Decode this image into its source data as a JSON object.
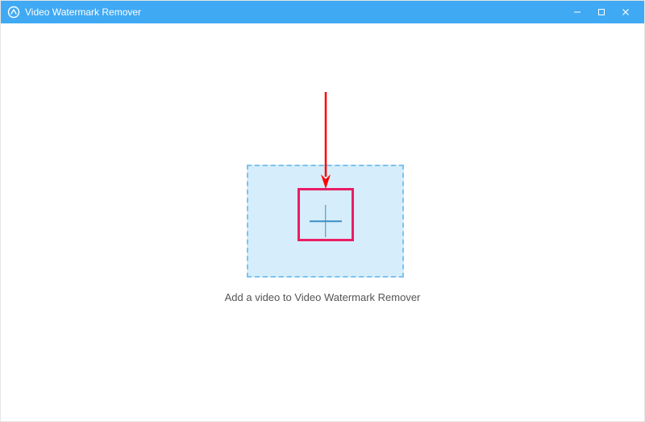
{
  "window": {
    "title": "Video Watermark Remover"
  },
  "main": {
    "hint": "Add a video to Video Watermark Remover"
  },
  "colors": {
    "accent": "#40a9f3",
    "dropzone_bg": "#d6edfb",
    "dropzone_border": "#7cc3ef",
    "highlight": "#e91e63",
    "arrow": "#ff0000"
  }
}
